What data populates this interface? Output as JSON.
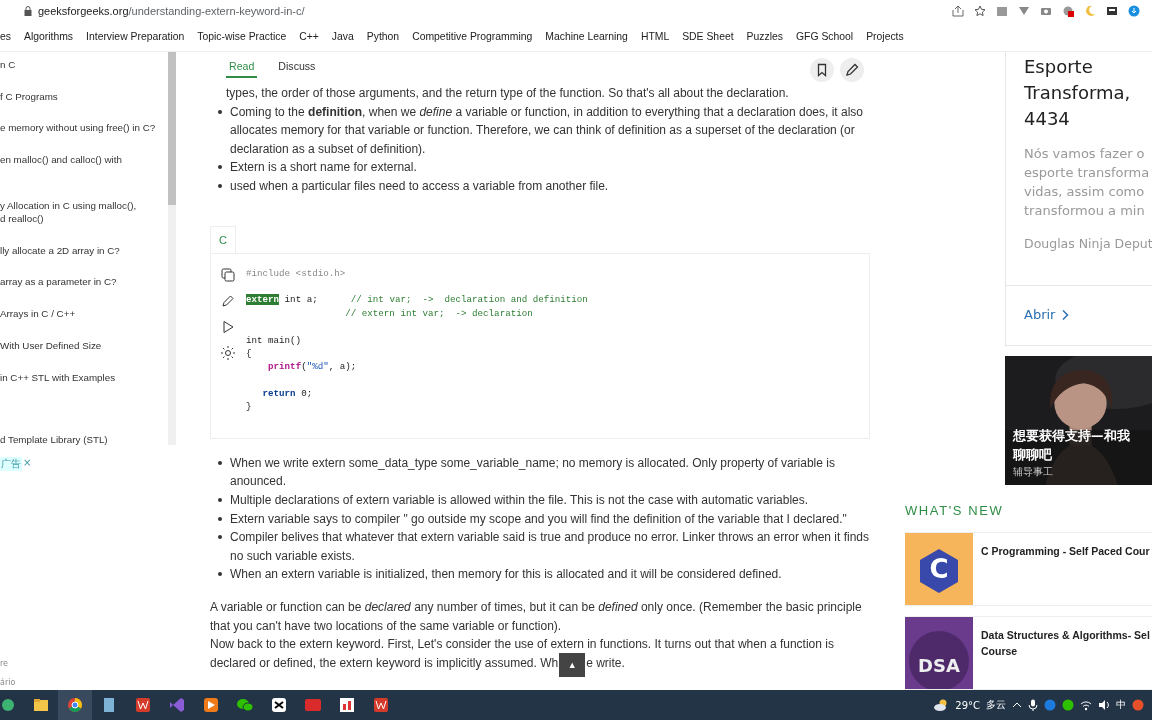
{
  "browser": {
    "url_host": "geeksforgeeks.org",
    "url_path": "/understanding-extern-keyword-in-c/"
  },
  "nav": [
    "es",
    "Algorithms",
    "Interview Preparation",
    "Topic-wise Practice",
    "C++",
    "Java",
    "Python",
    "Competitive Programming",
    "Machine Learning",
    "HTML",
    "SDE Sheet",
    "Puzzles",
    "GFG School",
    "Projects"
  ],
  "sidebar": {
    "items": [
      {
        "lines": [
          "n C"
        ]
      },
      {
        "lines": [
          "f C Programs"
        ]
      },
      {
        "lines": [
          "e memory without using free() in C?"
        ]
      },
      {
        "lines": [
          "en malloc() and calloc() with"
        ]
      },
      {
        "lines": [
          "y Allocation in C using malloc(),",
          "d realloc()"
        ]
      },
      {
        "lines": [
          "lly allocate a 2D array in C?"
        ]
      },
      {
        "lines": [
          "array as a parameter in C?"
        ]
      },
      {
        "lines": [
          "Arrays in C / C++"
        ]
      },
      {
        "lines": [
          "With User Defined Size"
        ]
      },
      {
        "lines": [
          "in C++ STL with Examples"
        ]
      },
      {
        "lines": [
          "d Template Library (STL)"
        ]
      }
    ],
    "ad_mark": "广告",
    "ad_close": "×",
    "fragments": [
      "re",
      "ário"
    ]
  },
  "article": {
    "tabs": [
      {
        "label": "Read",
        "selected": true
      },
      {
        "label": "Discuss",
        "selected": false
      }
    ],
    "intro": "types, the order of those arguments, and the return type of the function. So that's all about the declaration.",
    "bullets_top": [
      "Coming to the **definition**, when we *define* a variable or function, in addition to everything that a declaration does, it also allocates memory for that variable or function. Therefore, we can think of definition as a superset of the declaration (or declaration as a subset of definition).",
      "Extern is a short name for external.",
      "used when a particular files need to access a variable from another file."
    ],
    "code": {
      "language": "C",
      "lines": [
        {
          "space_before": false,
          "tokens": [
            {
              "kind": "preproc",
              "text": "#include <stdio.h>"
            }
          ]
        },
        {
          "space_before": true,
          "tokens": [
            {
              "kind": "selected",
              "text": "extern"
            },
            {
              "kind": "plain",
              "text": " int a;"
            },
            {
              "kind": "comment",
              "text": "      // int var;  ->  declaration and definition"
            }
          ]
        },
        {
          "space_before": false,
          "tokens": [
            {
              "kind": "comment",
              "text": "                  // extern int var;  -> declaration"
            }
          ]
        },
        {
          "space_before": true,
          "tokens": [
            {
              "kind": "plain",
              "text": "int main()"
            }
          ]
        },
        {
          "space_before": false,
          "tokens": [
            {
              "kind": "plain",
              "text": "{"
            }
          ]
        },
        {
          "space_before": false,
          "tokens": [
            {
              "kind": "function",
              "text": "    printf"
            },
            {
              "kind": "plain",
              "text": "("
            },
            {
              "kind": "string",
              "text": "\"%d\""
            },
            {
              "kind": "plain",
              "text": ", a);"
            }
          ]
        },
        {
          "space_before": true,
          "tokens": [
            {
              "kind": "keyword",
              "text": "   return"
            },
            {
              "kind": "plain",
              "text": " 0;"
            }
          ]
        },
        {
          "space_before": false,
          "tokens": [
            {
              "kind": "plain",
              "text": "}"
            }
          ]
        }
      ]
    },
    "bullets_bottom": [
      "When we write extern some_data_type some_variable_name;  no memory is allocated. Only property of variable is anounced.",
      "Multiple declarations of extern variable is allowed within the file. This is not the case with automatic variables.",
      "Extern variable says to compiler \" go outside my scope and you will find the definition of the variable that I declared.\"",
      "Compiler belives that whatever that extern variable said is true and produce no error. Linker throws an error when it finds no such variable exists.",
      "When an extern variable is initialized, then memory for this is allocated and it will be considered defined."
    ],
    "paragraph": "A variable or function can be *declared* any number of times, but it can be *defined* only once. (Remember the basic principle that you can't have two locations of the same variable or function).",
    "last_paragraph_lines": [
      "Now back to the extern keyword. First, Let's consider the use of extern in functions. It turns out that when a function is",
      "declared or defined, the extern keyword is implicitly assumed. Wh"
    ],
    "scroll_top": "▲",
    "last_paragraph_after": "e write."
  },
  "ad": {
    "title_lines": [
      "Esporte",
      "Transforma,",
      "4434"
    ],
    "body_lines": [
      "Nós vamos fazer o",
      "esporte transforma",
      "vidas, assim como",
      "transformou a min"
    ],
    "author": "Douglas Ninja Deput",
    "link": "Abrir",
    "photo": {
      "kind": "picture",
      "caption_lines": [
        "想要获得支持—和我",
        "聊聊吧"
      ],
      "sponsor": "辅导事工"
    }
  },
  "whats_new": {
    "heading": "WHAT'S NEW",
    "courses": [
      {
        "title_lines": [
          "C Programming - Self Paced Cour"
        ],
        "kind": "c",
        "logo_text": "C"
      },
      {
        "title_lines": [
          "Data Structures & Algorithms- Sel",
          "Course"
        ],
        "kind": "dsa",
        "logo_text": "DSA"
      }
    ]
  },
  "taskbar": {
    "temperature": "29°C",
    "weather": "多云",
    "ime": "中"
  }
}
